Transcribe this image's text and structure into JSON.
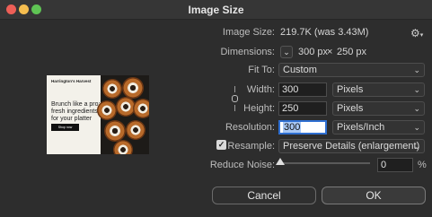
{
  "window": {
    "title": "Image Size"
  },
  "image_size": {
    "label": "Image Size:",
    "value": "219.7K (was 3.43M)"
  },
  "dimensions": {
    "label": "Dimensions:",
    "chevron": "⌄",
    "width_value": "300 px",
    "times": "×",
    "height_value": "250 px"
  },
  "fit_to": {
    "label": "Fit To:",
    "value": "Custom"
  },
  "width": {
    "label": "Width:",
    "value": "300",
    "unit": "Pixels"
  },
  "height": {
    "label": "Height:",
    "value": "250",
    "unit": "Pixels"
  },
  "resolution": {
    "label": "Resolution:",
    "value": "300",
    "unit": "Pixels/Inch"
  },
  "resample": {
    "label": "Resample:",
    "checked": true,
    "value": "Preserve Details (enlargement)"
  },
  "reduce_noise": {
    "label": "Reduce Noise:",
    "value": "0",
    "unit": "%",
    "level_percent": 0
  },
  "buttons": {
    "cancel": "Cancel",
    "ok": "OK"
  },
  "preview": {
    "brand": "Harrington's Harvest",
    "headline": "Brunch like a pro: fresh ingredients for your platter",
    "cta": "Shop now"
  },
  "icons": {
    "settings": "gear-icon",
    "link": "link-icon",
    "dropdown": "chevron-down-icon",
    "check": "check-icon"
  }
}
